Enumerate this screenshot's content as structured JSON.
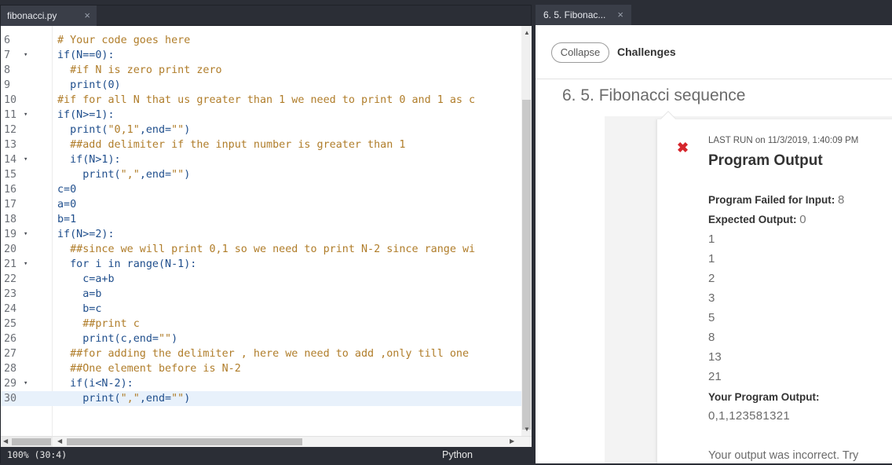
{
  "editor": {
    "tab_label": "fibonacci.py",
    "tab_close": "×",
    "lines": [
      {
        "num": "6",
        "fold": "",
        "segments": [
          {
            "t": "c",
            "v": "# Your code goes here"
          }
        ]
      },
      {
        "num": "7",
        "fold": "▾",
        "segments": [
          {
            "t": "n",
            "v": "if(N==0):"
          }
        ]
      },
      {
        "num": "8",
        "fold": "",
        "segments": [
          {
            "t": "c",
            "v": "  #if N is zero print zero"
          }
        ]
      },
      {
        "num": "9",
        "fold": "",
        "segments": [
          {
            "t": "n",
            "v": "  print(0)"
          }
        ]
      },
      {
        "num": "10",
        "fold": "",
        "segments": [
          {
            "t": "c",
            "v": "#if for all N that us greater than 1 we need to print 0 and 1 as c"
          }
        ]
      },
      {
        "num": "11",
        "fold": "▾",
        "segments": [
          {
            "t": "n",
            "v": "if(N>=1):"
          }
        ]
      },
      {
        "num": "12",
        "fold": "",
        "segments": [
          {
            "t": "n",
            "v": "  print("
          },
          {
            "t": "s",
            "v": "\"0,1\""
          },
          {
            "t": "n",
            "v": ",end="
          },
          {
            "t": "s",
            "v": "\"\""
          },
          {
            "t": "n",
            "v": ")"
          }
        ]
      },
      {
        "num": "13",
        "fold": "",
        "segments": [
          {
            "t": "c",
            "v": "  ##add delimiter if the input number is greater than 1"
          }
        ]
      },
      {
        "num": "14",
        "fold": "▾",
        "segments": [
          {
            "t": "n",
            "v": "  if(N>1):"
          }
        ]
      },
      {
        "num": "15",
        "fold": "",
        "segments": [
          {
            "t": "n",
            "v": "    print("
          },
          {
            "t": "s",
            "v": "\",\""
          },
          {
            "t": "n",
            "v": ",end="
          },
          {
            "t": "s",
            "v": "\"\""
          },
          {
            "t": "n",
            "v": ")"
          }
        ]
      },
      {
        "num": "16",
        "fold": "",
        "segments": [
          {
            "t": "n",
            "v": "c=0"
          }
        ]
      },
      {
        "num": "17",
        "fold": "",
        "segments": [
          {
            "t": "n",
            "v": "a=0"
          }
        ]
      },
      {
        "num": "18",
        "fold": "",
        "segments": [
          {
            "t": "n",
            "v": "b=1"
          }
        ]
      },
      {
        "num": "19",
        "fold": "▾",
        "segments": [
          {
            "t": "n",
            "v": "if(N>=2):"
          }
        ]
      },
      {
        "num": "20",
        "fold": "",
        "segments": [
          {
            "t": "c",
            "v": "  ##since we will print 0,1 so we need to print N-2 since range wi"
          }
        ]
      },
      {
        "num": "21",
        "fold": "▾",
        "segments": [
          {
            "t": "n",
            "v": "  for i in range(N-1):"
          }
        ]
      },
      {
        "num": "22",
        "fold": "",
        "segments": [
          {
            "t": "n",
            "v": "    c=a+b"
          }
        ]
      },
      {
        "num": "23",
        "fold": "",
        "segments": [
          {
            "t": "n",
            "v": "    a=b"
          }
        ]
      },
      {
        "num": "24",
        "fold": "",
        "segments": [
          {
            "t": "n",
            "v": "    b=c"
          }
        ]
      },
      {
        "num": "25",
        "fold": "",
        "segments": [
          {
            "t": "c",
            "v": "    ##print c"
          }
        ]
      },
      {
        "num": "26",
        "fold": "",
        "segments": [
          {
            "t": "n",
            "v": "    print(c,end="
          },
          {
            "t": "s",
            "v": "\"\""
          },
          {
            "t": "n",
            "v": ")"
          }
        ]
      },
      {
        "num": "27",
        "fold": "",
        "segments": [
          {
            "t": "c",
            "v": "  ##for adding the delimiter , here we need to add ,only till one"
          }
        ]
      },
      {
        "num": "28",
        "fold": "",
        "segments": [
          {
            "t": "c",
            "v": "  ##One element before is N-2"
          }
        ]
      },
      {
        "num": "29",
        "fold": "▾",
        "segments": [
          {
            "t": "n",
            "v": "  if(i<N-2):"
          }
        ]
      },
      {
        "num": "30",
        "fold": "",
        "segments": [
          {
            "t": "n",
            "v": "    print("
          },
          {
            "t": "s",
            "v": "\",\""
          },
          {
            "t": "n",
            "v": ",end="
          },
          {
            "t": "s",
            "v": "\"\""
          },
          {
            "t": "n",
            "v": ")"
          }
        ]
      }
    ],
    "active_line_index": 24,
    "status": {
      "position": "100%  (30:4)",
      "language": "Python"
    }
  },
  "panel": {
    "tab_label": "6. 5. Fibonac...",
    "tab_close": "×",
    "collapse_label": "Collapse",
    "challenges_label": "Challenges",
    "section_title": "6. 5. Fibonacci sequence",
    "fail_icon": "x-icon",
    "last_run": "LAST RUN on 11/3/2019, 1:40:09 PM",
    "output_title": "Program Output",
    "failed_label": "Program Failed for Input:",
    "failed_value": "8",
    "expected_label": "Expected Output:",
    "expected_value": "0",
    "expected_sequence": [
      "1",
      "1",
      "2",
      "3",
      "5",
      "8",
      "13",
      "21"
    ],
    "your_output_label": "Your Program Output:",
    "your_output_value": "0,1,123581321",
    "incorrect_text": "Your output was incorrect. Try"
  },
  "colors": {
    "accent_fail": "#d6262c",
    "comment": "#b07d2a",
    "code": "#1f4e8c"
  }
}
